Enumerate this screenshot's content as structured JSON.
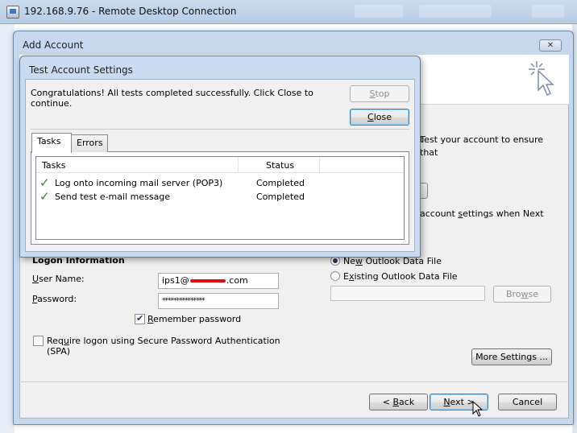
{
  "rdp": {
    "title": "192.168.9.76 - Remote Desktop Connection"
  },
  "add_account": {
    "title": "Add Account",
    "close_glyph": "✕",
    "intro_text": "Test your account to ensure that",
    "intro_prefix": "t",
    "settings_text_pre": "account ",
    "settings_text_s": "s",
    "settings_text_post": "ettings when Next",
    "logon_header": "Logon Information",
    "user_name_label_u": "U",
    "user_name_label_rest": "ser Name:",
    "user_name_pre": "ips1@",
    "user_name_post": ".com",
    "password_label_p": "P",
    "password_label_rest": "assword:",
    "password_value": "***************",
    "remember_r": "R",
    "remember_rest": "emember password",
    "remember_checked": true,
    "spa_pre": "Req",
    "spa_u": "u",
    "spa_post": "ire logon using Secure Password Authentication",
    "spa_line2": "(SPA)",
    "spa_checked": false,
    "new_pst_pre": "Ne",
    "new_pst_w": "w",
    "new_pst_post": " Outlook Data File",
    "existing_pst_pre": "E",
    "existing_pst_x": "x",
    "existing_pst_post": "isting Outlook Data File",
    "selected_option": "new",
    "browse_pre": "Bro",
    "browse_w": "w",
    "browse_post": "se",
    "more_settings": "More Settings ...",
    "back_pre": "< ",
    "back_b": "B",
    "back_post": "ack",
    "next_n": "N",
    "next_post": "ext >",
    "cancel": "Cancel"
  },
  "test_dialog": {
    "title": "Test Account Settings",
    "message_line1": "Congratulations! All tests completed successfully. Click Close to",
    "message_line2": "continue.",
    "stop_s": "S",
    "stop_rest": "top",
    "close_c": "C",
    "close_rest": "lose",
    "tabs": [
      "Tasks",
      "Errors"
    ],
    "active_tab": "Tasks",
    "columns": [
      "Tasks",
      "Status"
    ],
    "rows": [
      {
        "task": "Log onto incoming mail server (POP3)",
        "status": "Completed",
        "icon": "green-check-icon"
      },
      {
        "task": "Send test e-mail message",
        "status": "Completed",
        "icon": "green-check-icon"
      }
    ]
  },
  "colors": {
    "check": "#2e8b2e",
    "window_frame": "#c5d8ee",
    "redaction": "#e01010"
  }
}
